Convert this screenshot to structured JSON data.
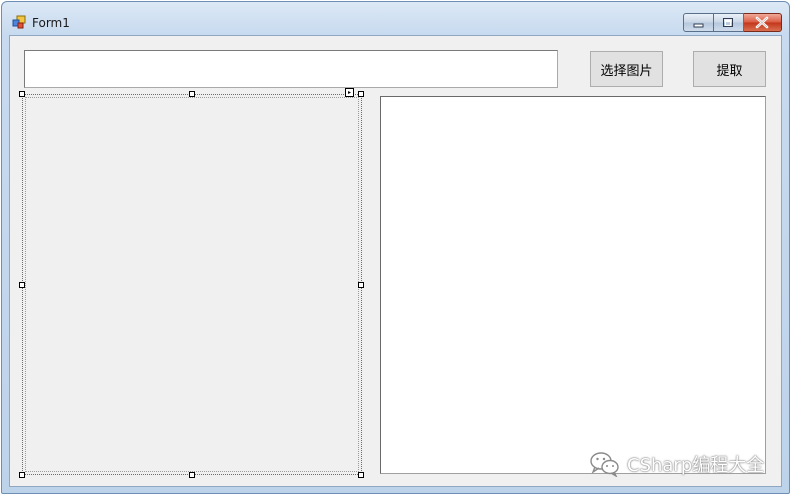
{
  "window": {
    "title": "Form1",
    "icon": "form-icon",
    "caption_buttons": [
      "minimize-icon",
      "maximize-icon",
      "close-icon"
    ]
  },
  "form": {
    "path_input": {
      "value": "",
      "placeholder": ""
    },
    "select_image_button": "选择图片",
    "extract_button": "提取",
    "picturebox": {
      "state": "selected-in-designer"
    },
    "result_box": {
      "value": ""
    }
  },
  "watermark": {
    "icon": "wechat-icon",
    "text": "CSharp编程大全"
  },
  "colors": {
    "form_background": "#f0f0f0",
    "button_face": "#e1e1e1",
    "title_gradient_top": "#dce8f5",
    "close_button": "#c2351a"
  }
}
